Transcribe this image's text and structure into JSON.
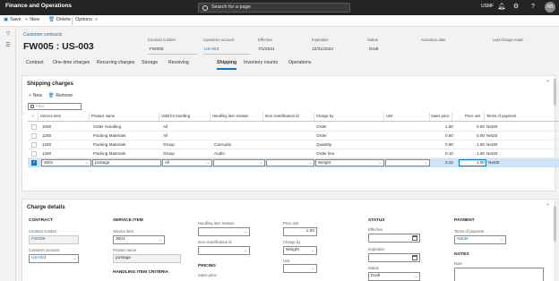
{
  "topbar": {
    "app_title": "Finance and Operations",
    "search_placeholder": "Search for a page",
    "company": "USMF",
    "avatar": "RB"
  },
  "actions": {
    "save": "Save",
    "new": "New",
    "delete": "Delete",
    "options": "Options"
  },
  "breadcrumb": "Customer contracts",
  "record_title": "FW005 : US-003",
  "header": {
    "contract_number_label": "Contract number",
    "contract_number": "FW005",
    "customer_account_label": "Customer account",
    "customer_account": "US-003",
    "effective_label": "Effective",
    "effective": "7/1/2021",
    "expiration_label": "Expiration",
    "expiration": "12/31/2022",
    "status_label": "Status",
    "status": "Draft",
    "activation_label": "Activation date",
    "activation": "",
    "last_change_label": "Last change made",
    "last_change": ""
  },
  "tabs": [
    "Contract",
    "One-time charges",
    "Recurring charges",
    "Storage",
    "Receiving",
    "Shipping",
    "Inventory counts",
    "Operations"
  ],
  "shipping": {
    "title": "Shipping charges",
    "new": "New",
    "remove": "Remove",
    "filter_placeholder": "Filter",
    "columns": [
      "Service item",
      "Product name",
      "Valid for handling",
      "Handling item relation",
      "Item classification id",
      "Charge by",
      "Unit",
      "Sales price",
      "Price unit",
      "Terms of payment"
    ],
    "rows": [
      {
        "service": "1060",
        "product": "Order Handling",
        "valid": "All",
        "relation": "",
        "classid": "",
        "charge": "Order",
        "unit": "",
        "price": "1.50",
        "punit": "0.00",
        "terms": "Net30"
      },
      {
        "service": "1260",
        "product": "Packing Materials",
        "valid": "All",
        "relation": "",
        "classid": "",
        "charge": "Order",
        "unit": "",
        "price": "0.60",
        "punit": "0.00",
        "terms": "Net30"
      },
      {
        "service": "1260",
        "product": "Packing Materials",
        "valid": "Group",
        "relation": "CarAudio",
        "classid": "",
        "charge": "Quantity",
        "unit": "",
        "price": "0.90",
        "punit": "1.00",
        "terms": "Net30"
      },
      {
        "service": "1260",
        "product": "Packing Materials",
        "valid": "Group",
        "relation": "Audio",
        "classid": "",
        "charge": "Order line",
        "unit": "",
        "price": "0.10",
        "punit": "1.00",
        "terms": "Net30"
      },
      {
        "service": "3001",
        "product": "postage",
        "valid": "All",
        "relation": "",
        "classid": "",
        "charge": "Weight",
        "unit": "",
        "price": "0.32",
        "punit": "1.00",
        "terms": "Net30"
      }
    ]
  },
  "details": {
    "title": "Charge details",
    "contract": {
      "heading": "CONTRACT",
      "number_label": "Contract number",
      "number": "FW005",
      "account_label": "Customer account",
      "account": "US-003"
    },
    "service": {
      "heading": "SERVICE ITEM",
      "item_label": "Service item",
      "item": "3001",
      "product_label": "Product name",
      "product": "postage",
      "criteria_heading": "HANDLING ITEM CRITERIA"
    },
    "relation": {
      "relation_label": "Handling item relation",
      "relation": "",
      "class_label": "Item classification id",
      "class": "",
      "pricing_heading": "PRICING",
      "sales_price_label": "Sales price"
    },
    "price": {
      "punit_label": "Price unit",
      "punit": "1.00",
      "charge_label": "Charge by",
      "charge": "Weight",
      "unit_label": "Unit",
      "unit": ""
    },
    "status": {
      "heading": "STATUS",
      "effective_label": "Effective",
      "effective": "",
      "expiration_label": "Expiration",
      "expiration": "",
      "status_label": "Status",
      "status": "Draft"
    },
    "payment": {
      "heading": "PAYMENT",
      "terms_label": "Terms of payment",
      "terms": "Net30",
      "notes_heading": "NOTES",
      "note_label": "Note"
    }
  }
}
